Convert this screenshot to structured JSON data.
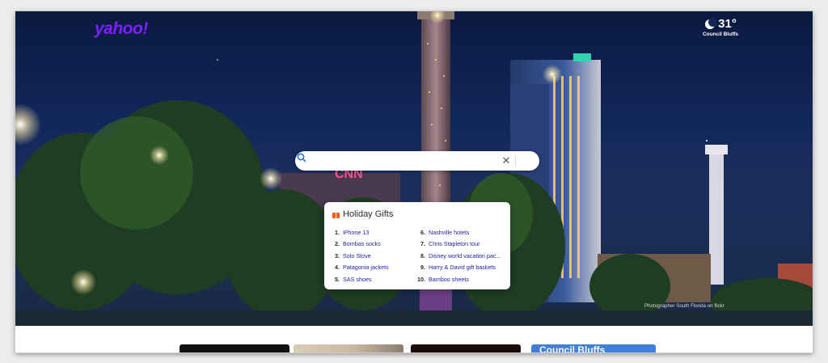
{
  "header": {
    "logo_text": "yahoo!",
    "brand_color": "#7e1fff"
  },
  "weather": {
    "icon": "moon-icon",
    "temp": "31°",
    "location": "Council Bluffs"
  },
  "search": {
    "placeholder": "",
    "value": "",
    "clear_icon": "close-icon",
    "submit_icon": "search-icon"
  },
  "trending": {
    "title": "Holiday Gifts",
    "icon": "gift-icon",
    "items": [
      {
        "num": "1.",
        "label": "iPhone 13"
      },
      {
        "num": "2.",
        "label": "Bombas socks"
      },
      {
        "num": "3.",
        "label": "Solo Stove"
      },
      {
        "num": "4.",
        "label": "Patagonia jackets"
      },
      {
        "num": "5.",
        "label": "SAS shoes"
      },
      {
        "num": "6.",
        "label": "Nashville hotels"
      },
      {
        "num": "7.",
        "label": "Chris Stapleton tour"
      },
      {
        "num": "8.",
        "label": "Disney world vacation pac..."
      },
      {
        "num": "9.",
        "label": "Harry & David gift baskets"
      },
      {
        "num": "10.",
        "label": "Bamboo sheets"
      }
    ]
  },
  "photo_credit": "Photographer South Florida on flickr",
  "cards": {
    "card4_title": "Council Bluffs"
  }
}
